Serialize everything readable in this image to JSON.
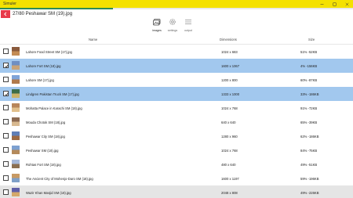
{
  "window": {
    "title": "Simuler",
    "controls": [
      "minimize-icon",
      "maximize-icon",
      "close-icon"
    ]
  },
  "progress": {
    "fraction": 0.32,
    "color": "#2e8b57"
  },
  "header": {
    "back_icon": "back-arrow-icon",
    "back_color": "#e83a4a",
    "status": "27/80 Peshawar SM (19).jpg"
  },
  "tabs": [
    {
      "label": "images",
      "icon": "images-icon",
      "active": true
    },
    {
      "label": "settings",
      "icon": "gear-icon",
      "active": false
    },
    {
      "label": "output",
      "icon": "output-icon",
      "active": false
    }
  ],
  "table": {
    "columns": {
      "name": "Name",
      "dimensions": "Dimensions",
      "size": "Size"
    },
    "rows": [
      {
        "name": "Lahore Food Street SM (17).jpg",
        "dimensions": "1024 x 683",
        "size": "51% -52KB",
        "checked": false,
        "state": "normal",
        "thumb": [
          "#8a5a3c",
          "#c48c54"
        ]
      },
      {
        "name": "Lahore Fort SM (18).jpg",
        "dimensions": "1600 x 1067",
        "size": "4% -156KB",
        "checked": true,
        "state": "selected",
        "thumb": [
          "#6f8fc2",
          "#c9a478"
        ]
      },
      {
        "name": "Lahore SM (17).jpg",
        "dimensions": "1200 x 800",
        "size": "60% -87KB",
        "checked": false,
        "state": "normal",
        "thumb": [
          "#7fa4d8",
          "#b07a4c"
        ]
      },
      {
        "name": "Lindgren Pakistan Truck SM (17).jpg",
        "dimensions": "1333 x 1000",
        "size": "33% -186KB",
        "checked": true,
        "state": "selected",
        "thumb": [
          "#3d6e4a",
          "#c9b36a"
        ]
      },
      {
        "name": "Mohatta Palace in Karachi SM (18).jpg",
        "dimensions": "1024 x 768",
        "size": "91% -72KB",
        "checked": false,
        "state": "normal",
        "thumb": [
          "#b8865a",
          "#e1c08c"
        ]
      },
      {
        "name": "Mouda Chotok SM (18).jpg",
        "dimensions": "640 x 640",
        "size": "65% -39KB",
        "checked": false,
        "state": "normal",
        "thumb": [
          "#8c6a52",
          "#d8b990"
        ]
      },
      {
        "name": "Peshawar City SM (18).jpg",
        "dimensions": "1280 x 960",
        "size": "62% -186KB",
        "checked": false,
        "state": "normal",
        "thumb": [
          "#5f7fb8",
          "#9c6a44"
        ]
      },
      {
        "name": "Peshawar SM (18).jpg",
        "dimensions": "1024 x 768",
        "size": "84% -75KB",
        "checked": false,
        "state": "normal",
        "thumb": [
          "#7da0d0",
          "#b48a5c"
        ]
      },
      {
        "name": "Rohtas Fort SM (18).jpg",
        "dimensions": "480 x 640",
        "size": "49% -51KB",
        "checked": false,
        "state": "normal",
        "thumb": [
          "#a6b8d8",
          "#8b6f50"
        ]
      },
      {
        "name": "The Ancient City of Mohenjo-Daro SM (18).jpg",
        "dimensions": "1600 x 1197",
        "size": "59% -196KB",
        "checked": false,
        "state": "normal",
        "thumb": [
          "#c89a64",
          "#7fa0c8"
        ]
      },
      {
        "name": "Wazir Khan Masjid SM (18).jpg",
        "dimensions": "2048 x 808",
        "size": "49% -226KB",
        "checked": false,
        "state": "hover",
        "thumb": [
          "#5f5fa8",
          "#d4a86a"
        ]
      }
    ]
  }
}
